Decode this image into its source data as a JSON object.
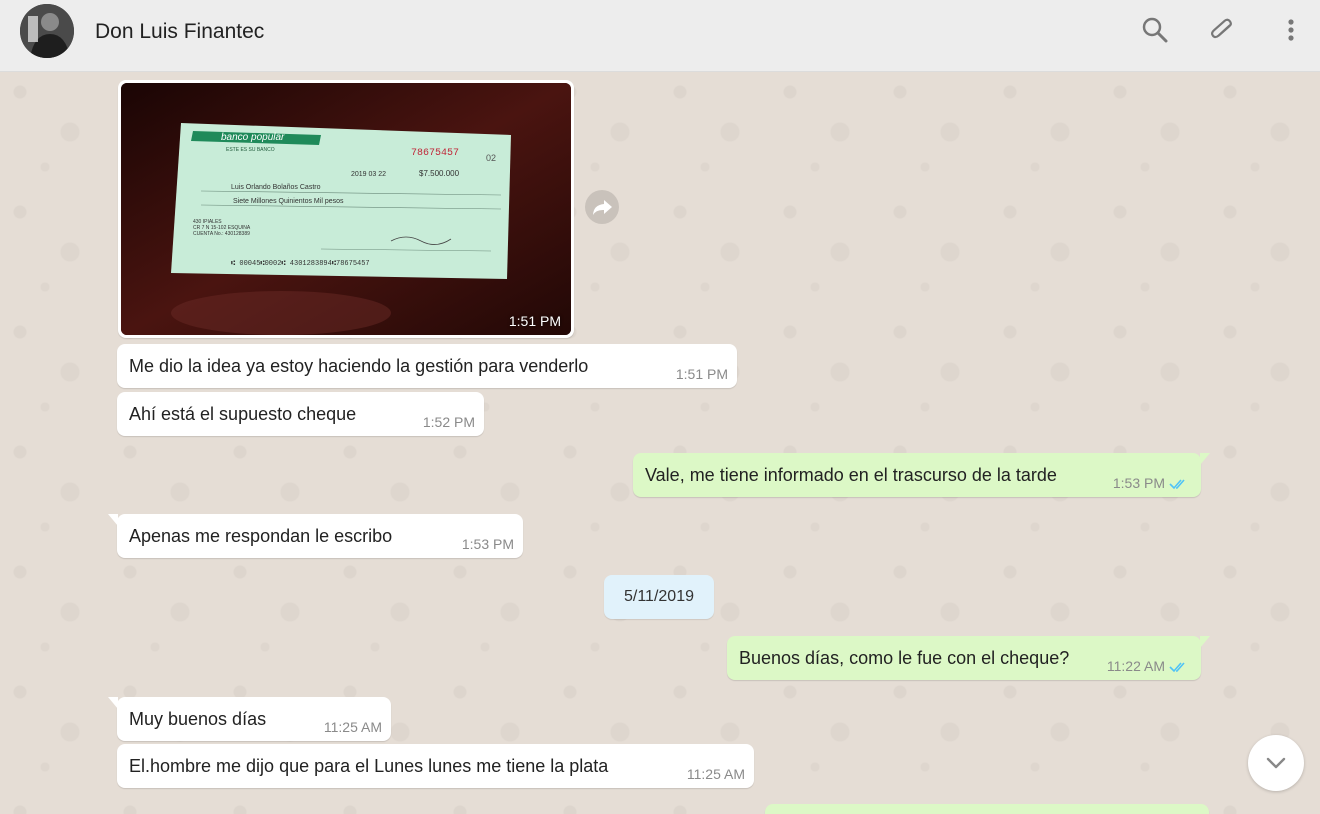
{
  "header": {
    "contact_name": "Don Luis Finantec"
  },
  "colors": {
    "incoming_bubble": "#ffffff",
    "outgoing_bubble": "#dcf8c6",
    "read_ticks": "#4fc3f7",
    "chat_background": "#e5ddd5",
    "date_pill": "#e1f2fb"
  },
  "messages": {
    "image_msg": {
      "time": "1:51 PM"
    },
    "m1": {
      "text": "Me dio la idea ya estoy haciendo la gestión para venderlo",
      "time": "1:51 PM"
    },
    "m2": {
      "text": "Ahí está el supuesto cheque",
      "time": "1:52 PM"
    },
    "m3": {
      "text": "Vale, me tiene informado en el trascurso de la tarde",
      "time": "1:53 PM"
    },
    "m4": {
      "text": "Apenas me respondan le escribo",
      "time": "1:53 PM"
    },
    "date_divider": "5/11/2019",
    "m5": {
      "text": "Buenos días, como le fue con el cheque?",
      "time": "11:22 AM"
    },
    "m6": {
      "text": "Muy buenos días",
      "time": "11:25 AM"
    },
    "m7": {
      "text": "El.hombre me dijo que para el Lunes lunes me tiene la plata",
      "time": "11:25 AM"
    }
  },
  "cheque": {
    "bank": "banco popular",
    "slogan": "ESTE ES SU BANCO",
    "number": "78675457",
    "branch": "02",
    "date": "2019 03 22",
    "amount": "$7.500.000",
    "payee": "Luis Orlando Bolaños Castro",
    "amount_words": "Siete Millones Quinientos Mil pesos",
    "branch_info": "430 IPIALES",
    "address": "CR 7 N 15-102 ESQUINA",
    "account": "CUENTA No.: 430128389",
    "micr": "⑆ 00045⑆0002⑆ 4301283894⑆78675457"
  }
}
